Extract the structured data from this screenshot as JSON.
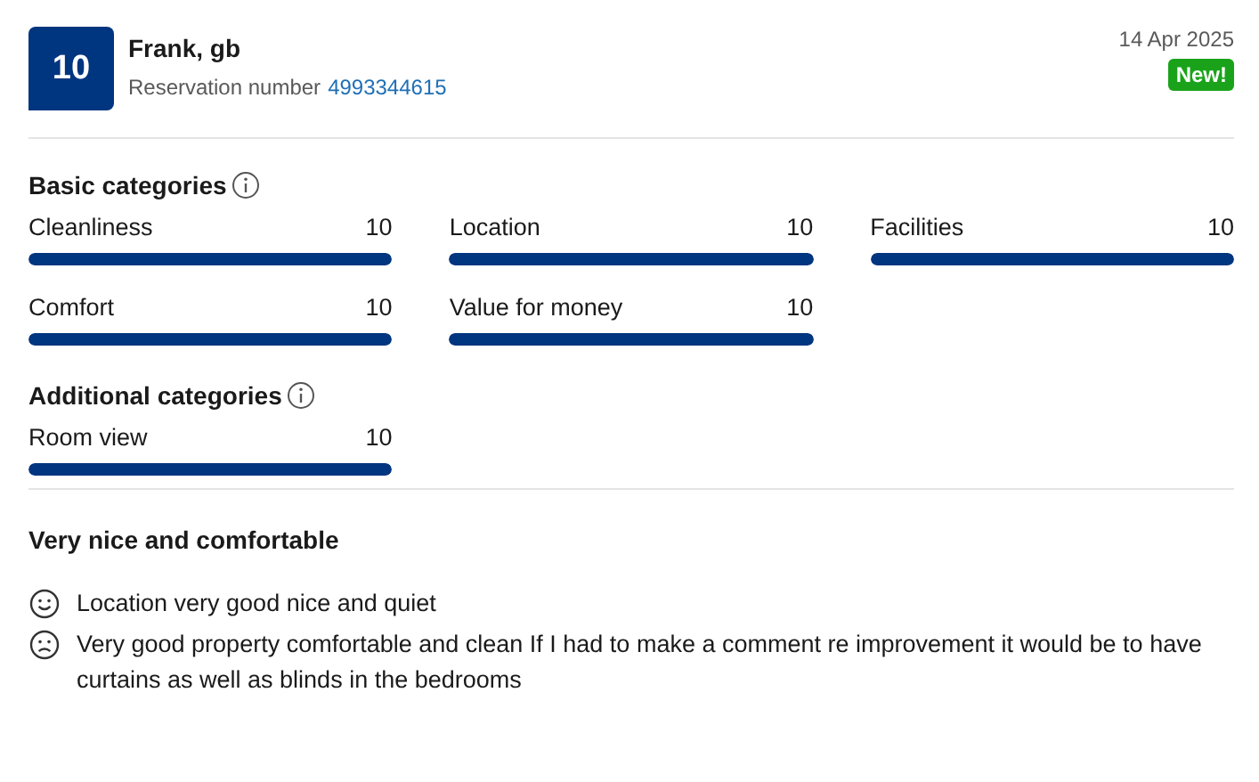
{
  "review": {
    "score": "10",
    "reviewer": "Frank, gb",
    "reservation_label": "Reservation number",
    "reservation_number": "4993344615",
    "date": "14 Apr 2025",
    "badge": "New!"
  },
  "sections": [
    {
      "title": "Basic categories",
      "categories": [
        {
          "name": "Cleanliness",
          "score": "10",
          "level": 1
        },
        {
          "name": "Location",
          "score": "10",
          "level": 1
        },
        {
          "name": "Facilities",
          "score": "10",
          "level": 1
        },
        {
          "name": "Comfort",
          "score": "10",
          "level": 1
        },
        {
          "name": "Value for money",
          "score": "10",
          "level": 1
        }
      ]
    },
    {
      "title": "Additional categories",
      "categories": [
        {
          "name": "Room view",
          "score": "10",
          "level": 1
        }
      ]
    }
  ],
  "review_title": "Very nice and comfortable",
  "comments": [
    {
      "kind": "positive",
      "text": "Location very good nice and quiet"
    },
    {
      "kind": "negative",
      "text": "Very good property comfortable and clean If I had to make a comment re improvement it would be to have curtains as well as blinds in the bedrooms"
    }
  ]
}
